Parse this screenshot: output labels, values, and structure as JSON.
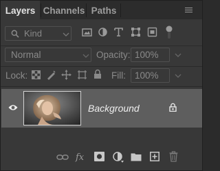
{
  "tabs": [
    {
      "label": "Layers",
      "active": true
    },
    {
      "label": "Channels",
      "active": false
    },
    {
      "label": "Paths",
      "active": false
    }
  ],
  "filter": {
    "kind_label": "Kind",
    "type_icons": [
      "image-filter-icon",
      "adjustment-filter-icon",
      "type-filter-icon",
      "shape-filter-icon",
      "smart-object-filter-icon"
    ]
  },
  "blend": {
    "mode": "Normal",
    "opacity_label": "Opacity:",
    "opacity_value": "100%"
  },
  "lock": {
    "label": "Lock:",
    "fill_label": "Fill:",
    "fill_value": "100%"
  },
  "layers": [
    {
      "name": "Background",
      "visible": true,
      "locked": true
    }
  ],
  "bottom_bar": [
    "link-layers-icon",
    "fx-icon",
    "add-mask-icon",
    "adjustment-layer-icon",
    "new-group-icon",
    "new-layer-icon",
    "delete-layer-icon"
  ],
  "colors": {
    "panel_bg": "#383838",
    "tab_bar_bg": "#2c2c2c",
    "selected_layer_bg": "#5e5e5e",
    "text": "#e4e4e4",
    "muted_text": "#8a8a8a"
  }
}
